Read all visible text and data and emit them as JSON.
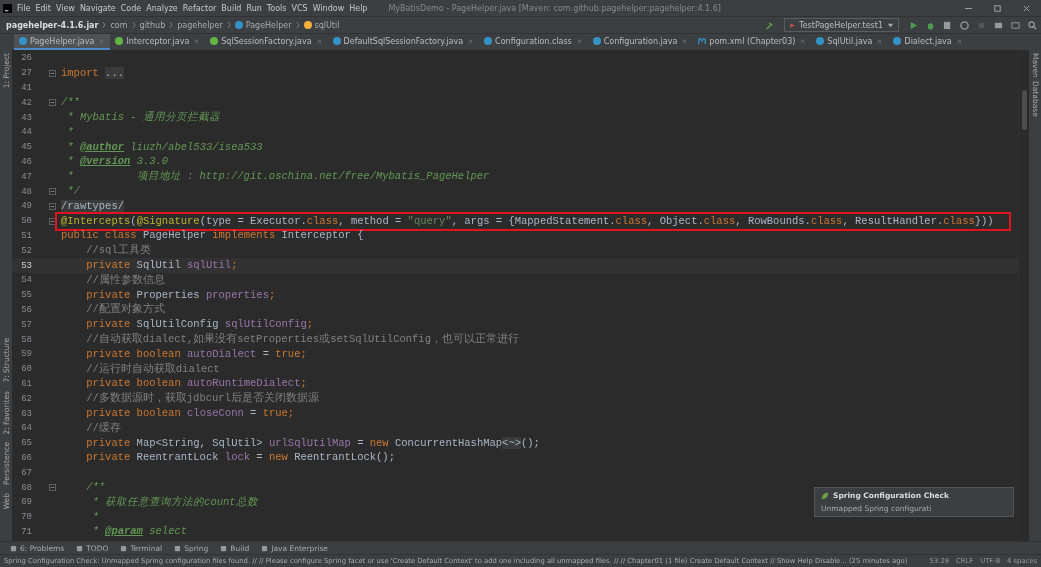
{
  "window": {
    "title": "MyBatisDemo - PageHelper.java [Maven: com.github.pagehelper:pagehelper:4.1.6]"
  },
  "menu": [
    "File",
    "Edit",
    "View",
    "Navigate",
    "Code",
    "Analyze",
    "Refactor",
    "Build",
    "Run",
    "Tools",
    "VCS",
    "Window",
    "Help"
  ],
  "breadcrumbs": [
    {
      "label": "pagehelper-4.1.6.jar",
      "kind": "jar"
    },
    {
      "label": "com",
      "kind": "package"
    },
    {
      "label": "github",
      "kind": "package"
    },
    {
      "label": "pagehelper",
      "kind": "package"
    },
    {
      "label": "PageHelper",
      "kind": "class"
    },
    {
      "label": "sqlUtil",
      "kind": "field"
    }
  ],
  "run_config": "TestPageHelper.test1",
  "tabs": [
    {
      "label": "PageHelper.java",
      "kind": "class",
      "selected": true
    },
    {
      "label": "Interceptor.java",
      "kind": "interface",
      "selected": false
    },
    {
      "label": "SqlSessionFactory.java",
      "kind": "interface",
      "selected": false
    },
    {
      "label": "DefaultSqlSessionFactory.java",
      "kind": "class",
      "selected": false
    },
    {
      "label": "Configuration.class",
      "kind": "class",
      "selected": false
    },
    {
      "label": "Configuration.java",
      "kind": "class",
      "selected": false
    },
    {
      "label": "pom.xml (Chapter03)",
      "kind": "maven",
      "selected": false
    },
    {
      "label": "SqlUtil.java",
      "kind": "class",
      "selected": false
    },
    {
      "label": "Dialect.java",
      "kind": "class",
      "selected": false
    }
  ],
  "left_tools": [
    "1: Project",
    "7: Structure",
    "2: Favorites",
    "Persistence",
    "Web"
  ],
  "right_tools": [
    "Maven",
    "Database"
  ],
  "code": [
    {
      "num": "26",
      "current": false,
      "fold": false
    },
    {
      "num": "27",
      "current": false,
      "fold": true,
      "tokens": [
        {
          "text": "import ",
          "kind": "kw"
        },
        {
          "text": "...",
          "kind": "folded"
        }
      ]
    },
    {
      "num": "41",
      "current": false,
      "fold": false
    },
    {
      "num": "42",
      "current": false,
      "fold": true,
      "tokens": [
        {
          "text": "/**",
          "kind": "doc"
        }
      ]
    },
    {
      "num": "43",
      "current": false,
      "fold": false,
      "tokens": [
        {
          "text": " * Mybatis - 通用分页拦截器",
          "kind": "doc"
        }
      ]
    },
    {
      "num": "44",
      "current": false,
      "fold": false,
      "tokens": [
        {
          "text": " *",
          "kind": "doc"
        }
      ]
    },
    {
      "num": "45",
      "current": false,
      "fold": false,
      "tokens": [
        {
          "text": " * ",
          "kind": "doc"
        },
        {
          "text": "@author",
          "kind": "doctag"
        },
        {
          "text": " liuzh/abel533/isea533",
          "kind": "doc"
        }
      ]
    },
    {
      "num": "46",
      "current": false,
      "fold": false,
      "tokens": [
        {
          "text": " * ",
          "kind": "doc"
        },
        {
          "text": "@version",
          "kind": "doctag"
        },
        {
          "text": " 3.3.0",
          "kind": "doc"
        }
      ]
    },
    {
      "num": "47",
      "current": false,
      "fold": false,
      "tokens": [
        {
          "text": " *          项目地址 : http://git.oschina.net/free/Mybatis_PageHelper",
          "kind": "doc"
        }
      ]
    },
    {
      "num": "48",
      "current": false,
      "fold": true,
      "tokens": [
        {
          "text": " */",
          "kind": "doc"
        }
      ]
    },
    {
      "num": "49",
      "current": false,
      "fold": true,
      "tokens": [
        {
          "text": "/rawtypes/",
          "kind": "folded"
        }
      ]
    },
    {
      "num": "50",
      "current": false,
      "fold": true,
      "highlighted": true,
      "tokens": [
        {
          "text": "@Intercepts",
          "kind": "ann"
        },
        {
          "text": "(",
          "kind": "p"
        },
        {
          "text": "@Signature",
          "kind": "ann"
        },
        {
          "text": "(type = Executor.",
          "kind": "p"
        },
        {
          "text": "class",
          "kind": "kw"
        },
        {
          "text": ", method = ",
          "kind": "p"
        },
        {
          "text": "\"query\"",
          "kind": "str"
        },
        {
          "text": ", args = {MappedStatement.",
          "kind": "p"
        },
        {
          "text": "class",
          "kind": "kw"
        },
        {
          "text": ", Object.",
          "kind": "p"
        },
        {
          "text": "class",
          "kind": "kw"
        },
        {
          "text": ", RowBounds.",
          "kind": "p"
        },
        {
          "text": "class",
          "kind": "kw"
        },
        {
          "text": ", ResultHandler.",
          "kind": "p"
        },
        {
          "text": "class",
          "kind": "kw"
        },
        {
          "text": "}))",
          "kind": "p"
        }
      ]
    },
    {
      "num": "51",
      "current": false,
      "fold": false,
      "tokens": [
        {
          "text": "public class",
          "kind": "kw"
        },
        {
          "text": " PageHelper ",
          "kind": "p"
        },
        {
          "text": "implements",
          "kind": "kw"
        },
        {
          "text": " Interceptor {",
          "kind": "p"
        }
      ]
    },
    {
      "num": "52",
      "current": false,
      "fold": false,
      "tokens": [
        {
          "text": "    //sql工具类",
          "kind": "comment"
        }
      ]
    },
    {
      "num": "53",
      "current": true,
      "fold": false,
      "tokens": [
        {
          "text": "    private",
          "kind": "kw"
        },
        {
          "text": " SqlUtil ",
          "kind": "p"
        },
        {
          "text": "sqlUtil",
          "kind": "field"
        },
        {
          "text": ";",
          "kind": "kw"
        }
      ]
    },
    {
      "num": "54",
      "current": false,
      "fold": false,
      "tokens": [
        {
          "text": "    //属性参数信息",
          "kind": "comment"
        }
      ]
    },
    {
      "num": "55",
      "current": false,
      "fold": false,
      "tokens": [
        {
          "text": "    private",
          "kind": "kw"
        },
        {
          "text": " Properties ",
          "kind": "p"
        },
        {
          "text": "properties",
          "kind": "field"
        },
        {
          "text": ";",
          "kind": "kw"
        }
      ]
    },
    {
      "num": "56",
      "current": false,
      "fold": false,
      "tokens": [
        {
          "text": "    //配置对象方式",
          "kind": "comment"
        }
      ]
    },
    {
      "num": "57",
      "current": false,
      "fold": false,
      "tokens": [
        {
          "text": "    private",
          "kind": "kw"
        },
        {
          "text": " SqlUtilConfig ",
          "kind": "p"
        },
        {
          "text": "sqlUtilConfig",
          "kind": "field"
        },
        {
          "text": ";",
          "kind": "kw"
        }
      ]
    },
    {
      "num": "58",
      "current": false,
      "fold": false,
      "tokens": [
        {
          "text": "    //自动获取dialect,如果没有setProperties或setSqlUtilConfig，也可以正常进行",
          "kind": "comment"
        }
      ]
    },
    {
      "num": "59",
      "current": false,
      "fold": false,
      "tokens": [
        {
          "text": "    private boolean ",
          "kind": "kw"
        },
        {
          "text": "autoDialect",
          "kind": "field"
        },
        {
          "text": " = ",
          "kind": "p"
        },
        {
          "text": "true;",
          "kind": "kw"
        }
      ]
    },
    {
      "num": "60",
      "current": false,
      "fold": false,
      "tokens": [
        {
          "text": "    //运行时自动获取dialect",
          "kind": "comment"
        }
      ]
    },
    {
      "num": "61",
      "current": false,
      "fold": false,
      "tokens": [
        {
          "text": "    private boolean ",
          "kind": "kw"
        },
        {
          "text": "autoRuntimeDialect",
          "kind": "field"
        },
        {
          "text": ";",
          "kind": "kw"
        }
      ]
    },
    {
      "num": "62",
      "current": false,
      "fold": false,
      "tokens": [
        {
          "text": "    //多数据源时，获取jdbcurl后是否关闭数据源",
          "kind": "comment"
        }
      ]
    },
    {
      "num": "63",
      "current": false,
      "fold": false,
      "tokens": [
        {
          "text": "    private boolean ",
          "kind": "kw"
        },
        {
          "text": "closeConn",
          "kind": "field"
        },
        {
          "text": " = ",
          "kind": "p"
        },
        {
          "text": "true;",
          "kind": "kw"
        }
      ]
    },
    {
      "num": "64",
      "current": false,
      "fold": false,
      "tokens": [
        {
          "text": "    //缓存",
          "kind": "comment"
        }
      ]
    },
    {
      "num": "65",
      "current": false,
      "fold": false,
      "tokens": [
        {
          "text": "    private",
          "kind": "kw"
        },
        {
          "text": " Map<String, SqlUtil> ",
          "kind": "p"
        },
        {
          "text": "urlSqlUtilMap",
          "kind": "field"
        },
        {
          "text": " = ",
          "kind": "p"
        },
        {
          "text": "new",
          "kind": "kw"
        },
        {
          "text": " ConcurrentHashMap",
          "kind": "p"
        },
        {
          "text": "<~>",
          "kind": "folded"
        },
        {
          "text": "();",
          "kind": "p"
        }
      ]
    },
    {
      "num": "66",
      "current": false,
      "fold": false,
      "tokens": [
        {
          "text": "    private",
          "kind": "kw"
        },
        {
          "text": " ReentrantLock ",
          "kind": "p"
        },
        {
          "text": "lock",
          "kind": "field"
        },
        {
          "text": " = ",
          "kind": "p"
        },
        {
          "text": "new",
          "kind": "kw"
        },
        {
          "text": " ReentrantLock();",
          "kind": "p"
        }
      ]
    },
    {
      "num": "67",
      "current": false,
      "fold": false
    },
    {
      "num": "68",
      "current": false,
      "fold": true,
      "tokens": [
        {
          "text": "    /**",
          "kind": "doc"
        }
      ]
    },
    {
      "num": "69",
      "current": false,
      "fold": false,
      "tokens": [
        {
          "text": "     * 获取任意查询方法的count总数",
          "kind": "doc"
        }
      ]
    },
    {
      "num": "70",
      "current": false,
      "fold": false,
      "tokens": [
        {
          "text": "     *",
          "kind": "doc"
        }
      ]
    },
    {
      "num": "71",
      "current": false,
      "fold": false,
      "tokens": [
        {
          "text": "     * ",
          "kind": "doc"
        },
        {
          "text": "@param",
          "kind": "doctag"
        },
        {
          "text": " select",
          "kind": "doc"
        }
      ]
    }
  ],
  "notification": {
    "title": "Spring Configuration Check",
    "body": "Unmapped Spring configurati"
  },
  "tool_windows": [
    "6: Problems",
    "TODO",
    "Terminal",
    "Spring",
    "Build",
    "Java Enterprise"
  ],
  "status_bar": {
    "message": "Spring Configuration Check: Unmapped Spring configuration files found. // // Please configure Spring facet or use 'Create Default Context' to add one including all unmapped files. // // Chapter01 (1 file)   Create Default Context // Show Help   Disable... (25 minutes ago)",
    "items": [
      "53:29",
      "CRLF",
      "UTF-8",
      "4 spaces"
    ]
  }
}
